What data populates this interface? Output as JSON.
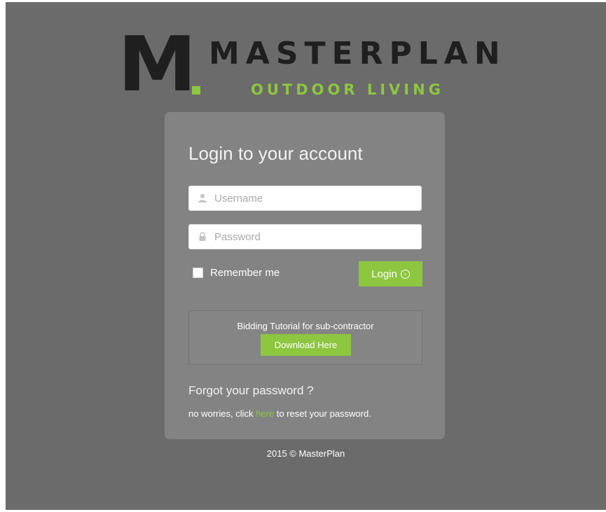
{
  "logo": {
    "mark": "M",
    "brand": "MASTERPLAN",
    "tagline": "OUTDOOR LIVING"
  },
  "login": {
    "title": "Login to your account",
    "username_placeholder": "Username",
    "password_placeholder": "Password",
    "remember_label": "Remember me",
    "login_label": "Login"
  },
  "tutorial": {
    "text": "Bidding Tutorial for sub-contractor",
    "download_label": "Download Here"
  },
  "forgot": {
    "title": "Forgot your password ?",
    "text_before": "no worries, click ",
    "link_label": "here",
    "text_after": " to reset your password."
  },
  "footer": {
    "copyright": "2015 © MasterPlan"
  },
  "colors": {
    "accent": "#8dc63f",
    "background": "#6b6b6b",
    "panel": "#838383"
  },
  "icons": {
    "username": "user-icon",
    "password": "lock-icon",
    "login": "arrow-circle-right-icon"
  }
}
